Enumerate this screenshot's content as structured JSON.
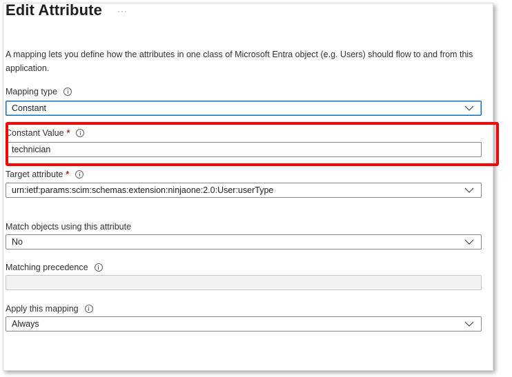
{
  "header": {
    "title": "Edit Attribute",
    "more_label": "···"
  },
  "description": "A mapping lets you define how the attributes in one class of Microsoft Entra object (e.g. Users) should flow to and from this application.",
  "fields": {
    "mapping_type": {
      "label": "Mapping type",
      "value": "Constant",
      "required": false,
      "has_info": true,
      "kind": "dropdown"
    },
    "constant_value": {
      "label": "Constant Value",
      "required_marker": "*",
      "value": "technician",
      "has_info": true,
      "kind": "textbox",
      "highlighted": true
    },
    "target_attribute": {
      "label": "Target attribute",
      "required_marker": "*",
      "value": "urn:ietf:params:scim:schemas:extension:ninjaone:2.0:User:userType",
      "has_info": true,
      "kind": "dropdown"
    },
    "match_objects": {
      "label": "Match objects using this attribute",
      "value": "No",
      "kind": "dropdown"
    },
    "matching_precedence": {
      "label": "Matching precedence",
      "value": "",
      "has_info": true,
      "kind": "textbox",
      "disabled": true
    },
    "apply_mapping": {
      "label": "Apply this mapping",
      "value": "Always",
      "has_info": true,
      "kind": "dropdown"
    }
  },
  "colors": {
    "highlight": "#ff0000",
    "focus_border": "#0f6cbd",
    "required": "#a4262c",
    "disabled_bg": "#f3f2f1"
  }
}
